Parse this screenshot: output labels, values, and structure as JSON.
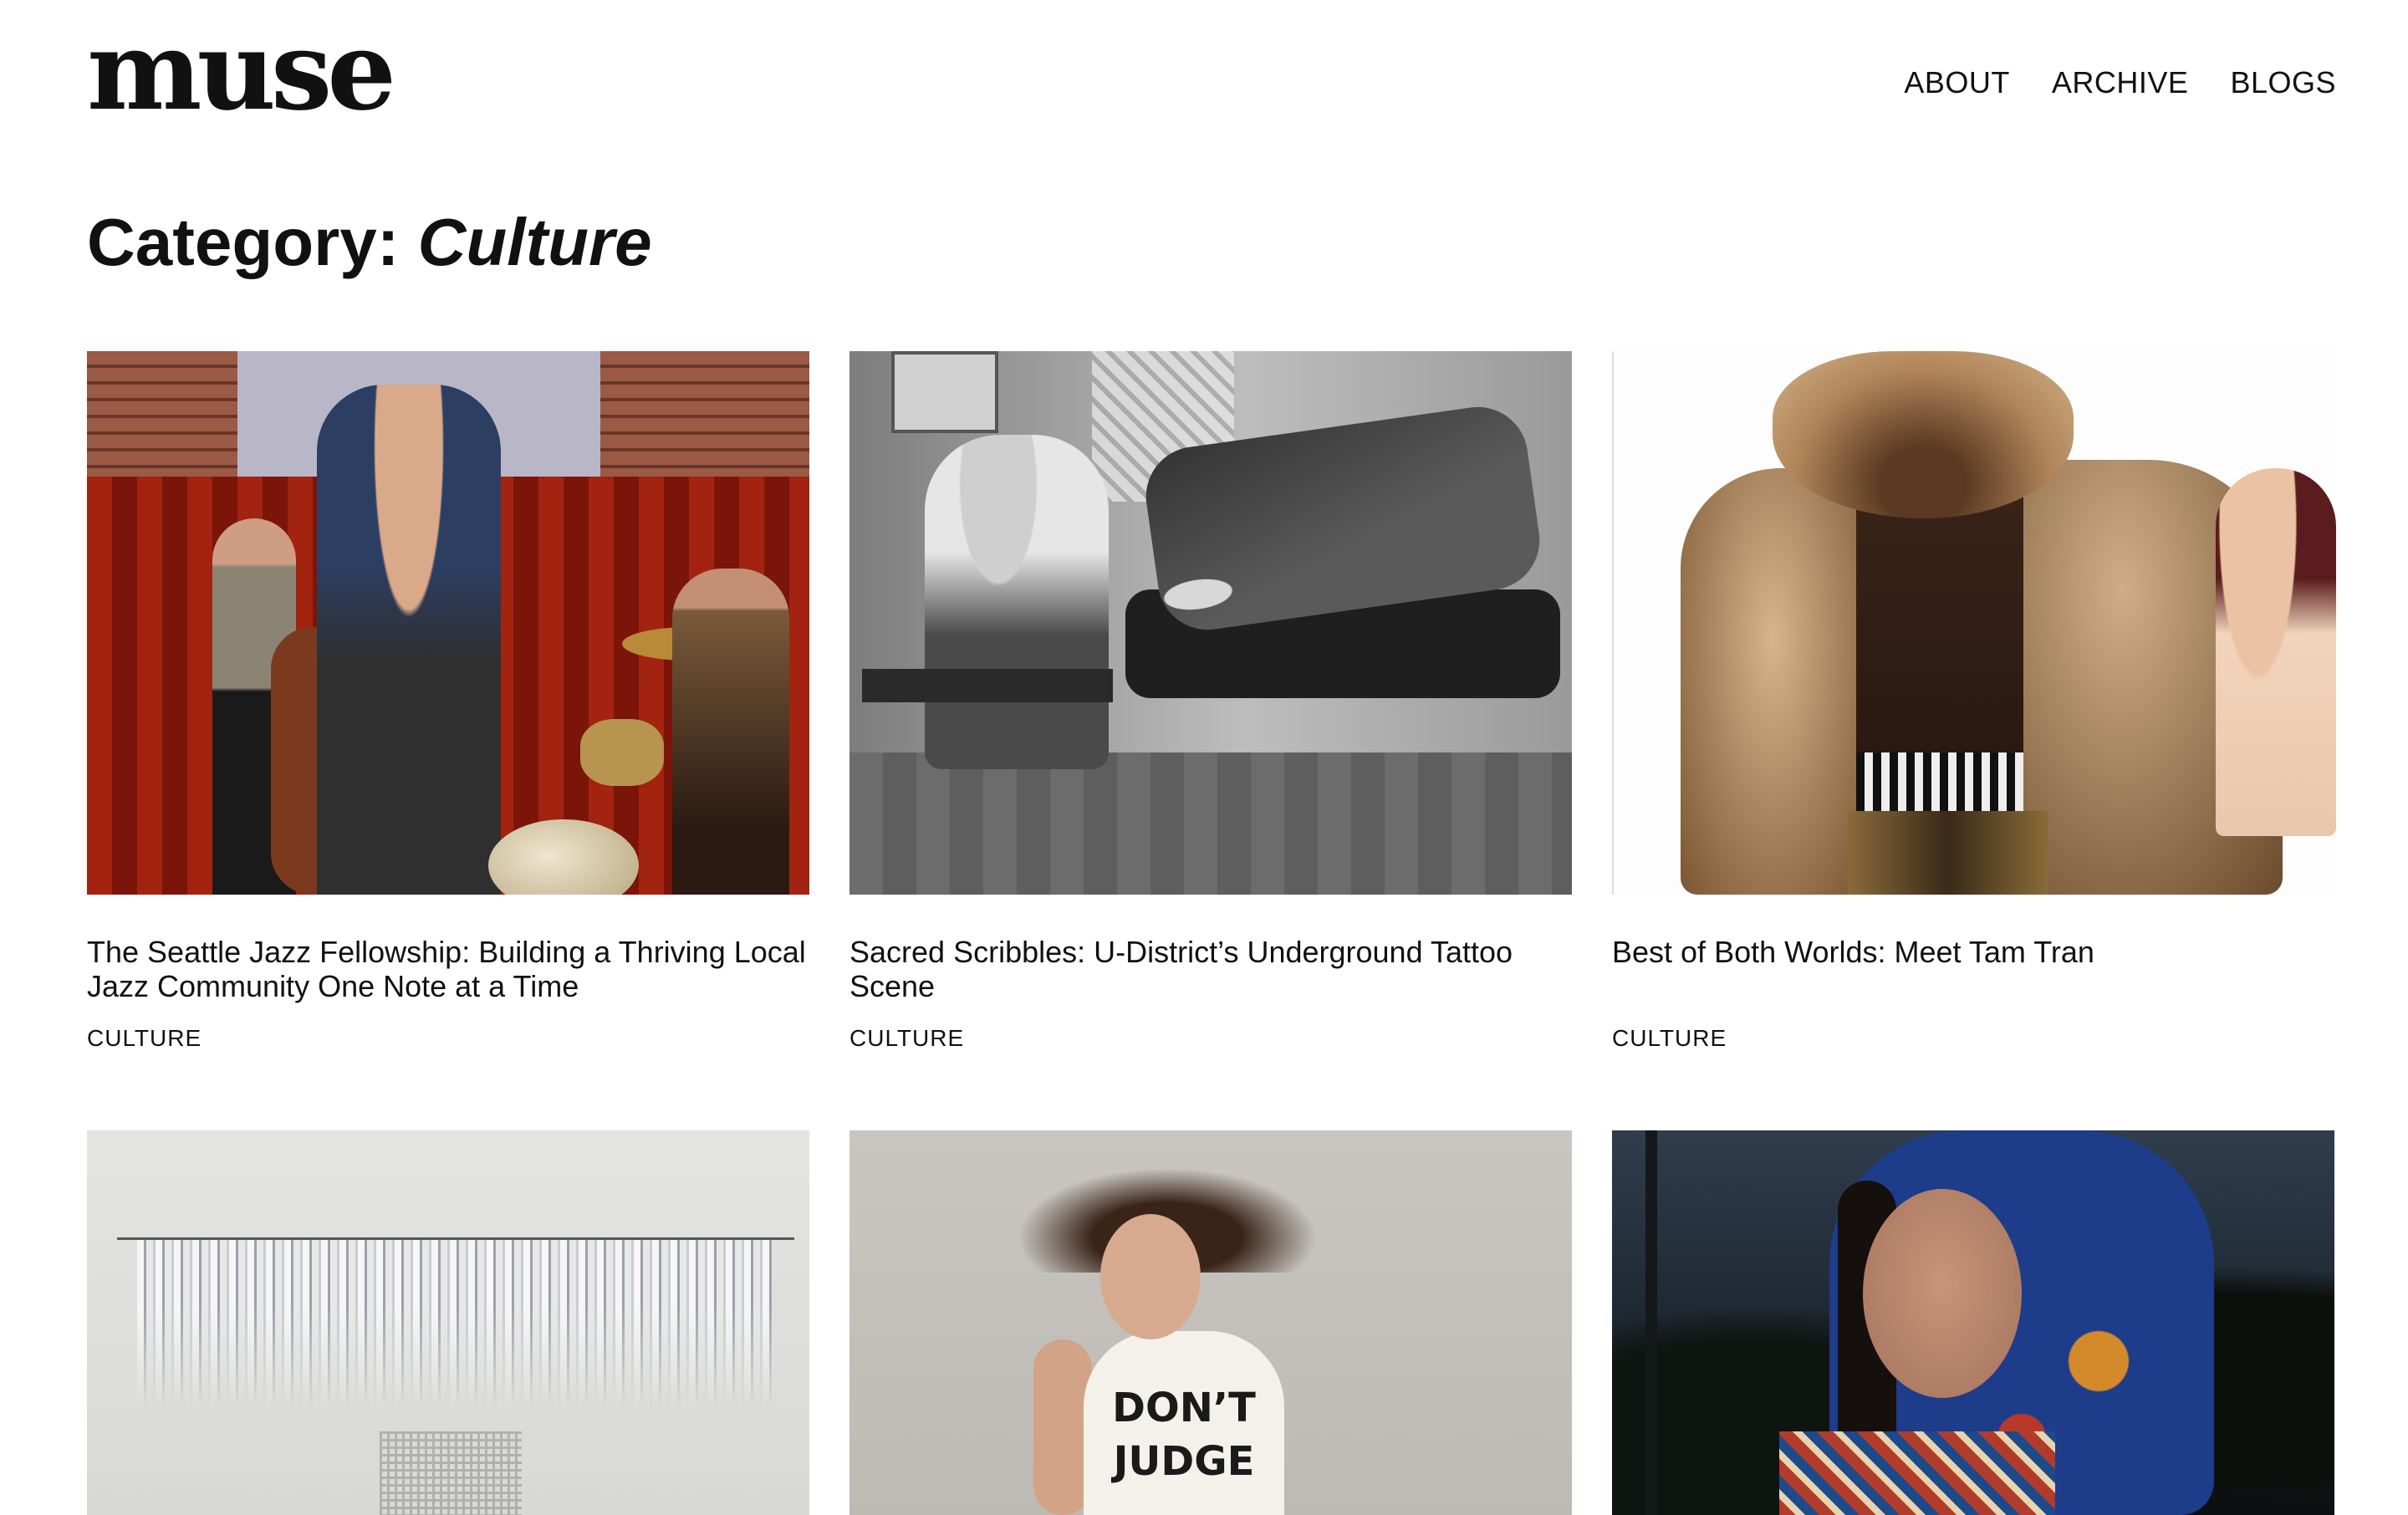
{
  "site": {
    "logo": "muse"
  },
  "nav": {
    "items": [
      "ABOUT",
      "ARCHIVE",
      "BLOGS"
    ]
  },
  "page": {
    "title_prefix": "Category: ",
    "title_category": "Culture"
  },
  "posts": [
    {
      "title": "The Seattle Jazz Fellowship: Building a Thriving Local Jazz Community One Note at a Time",
      "category": "CULTURE"
    },
    {
      "title": "Sacred Scribbles: U-District’s Underground Tattoo Scene",
      "category": "CULTURE"
    },
    {
      "title": "Best of Both Worlds: Meet Tam Tran",
      "category": "CULTURE"
    },
    {
      "title": "",
      "category": ""
    },
    {
      "title": "",
      "category": ""
    },
    {
      "title": "",
      "category": ""
    }
  ],
  "photo_text": {
    "shirt_line1": "DON’T",
    "shirt_line2": "JUDGE"
  }
}
